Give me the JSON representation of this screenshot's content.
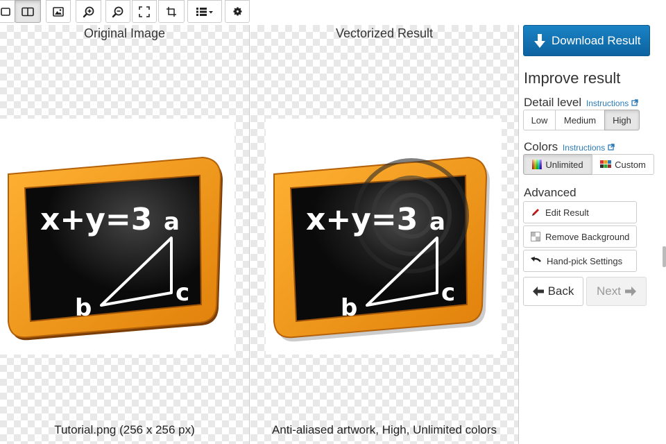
{
  "toolbar": {
    "buttons": [
      {
        "name": "view-single-button",
        "icon": "single-view-icon",
        "active": false
      },
      {
        "name": "view-split-button",
        "icon": "split-view-icon",
        "active": true
      },
      {
        "name": "view-image-button",
        "icon": "image-icon",
        "active": false
      },
      {
        "name": "zoom-in-button",
        "icon": "zoom-in-icon",
        "active": false
      },
      {
        "name": "zoom-out-button",
        "icon": "zoom-out-icon",
        "active": false
      },
      {
        "name": "fit-button",
        "icon": "fit-screen-icon",
        "active": false
      },
      {
        "name": "crop-button",
        "icon": "crop-icon",
        "active": false
      },
      {
        "name": "list-menu-button",
        "icon": "list-dropdown-icon",
        "active": false
      },
      {
        "name": "settings-button",
        "icon": "gear-icon",
        "active": false
      }
    ],
    "close_icon": "close-icon"
  },
  "left_pane": {
    "title": "Original Image",
    "caption": "Tutorial.png (256 x 256 px)"
  },
  "right_pane": {
    "title": "Vectorized Result",
    "caption": "Anti-aliased artwork, High, Unlimited colors"
  },
  "chalkboard": {
    "equation": "x+y=3",
    "label_a": "a",
    "label_b": "b",
    "label_c": "c",
    "frame_color": "#f29a16",
    "board_color": "#0d0d0d"
  },
  "sidebar": {
    "download_label": "Download Result",
    "improve_title": "Improve result",
    "detail_level": {
      "title": "Detail level",
      "instructions": "Instructions",
      "options": [
        "Low",
        "Medium",
        "High"
      ],
      "selected": "High"
    },
    "colors": {
      "title": "Colors",
      "instructions": "Instructions",
      "options": [
        "Unlimited",
        "Custom"
      ],
      "selected": "Unlimited"
    },
    "advanced": {
      "title": "Advanced",
      "edit_result": "Edit Result",
      "remove_background": "Remove Background",
      "hand_pick": "Hand-pick Settings"
    },
    "back_label": "Back",
    "next_label": "Next"
  },
  "colors": {
    "accent": "#1476b8",
    "close": "#d9534f",
    "link": "#2a7ab8"
  }
}
